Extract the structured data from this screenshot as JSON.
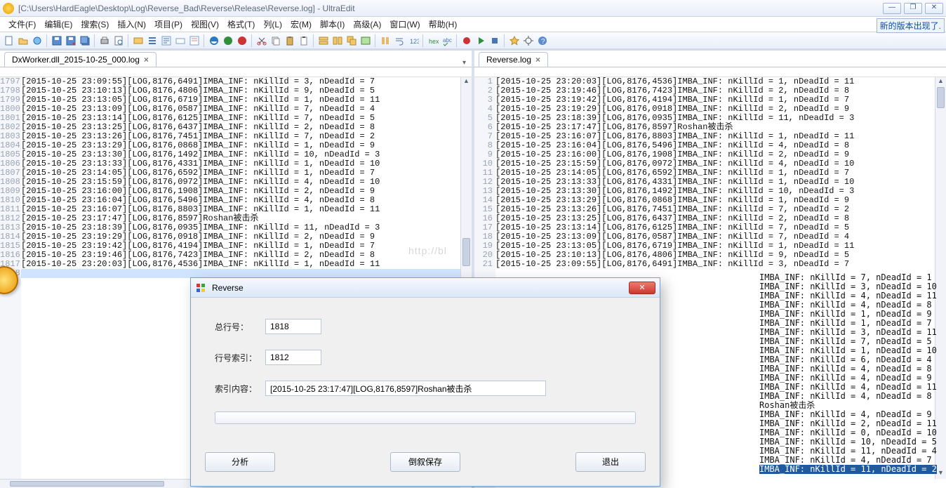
{
  "app": {
    "title": "[C:\\Users\\HardEagle\\Desktop\\Log\\Reverse_Bad\\Reverse\\Release\\Reverse.log] - UltraEdit",
    "new_version": "新的版本出现了."
  },
  "menu": [
    "文件(F)",
    "编辑(E)",
    "搜索(S)",
    "插入(N)",
    "项目(P)",
    "视图(V)",
    "格式(T)",
    "列(L)",
    "宏(M)",
    "脚本(I)",
    "高级(A)",
    "窗口(W)",
    "帮助(H)"
  ],
  "tabs": {
    "left": "DxWorker.dll_2015-10-25_000.log",
    "right": "Reverse.log"
  },
  "left_editor": {
    "first_lineno": 1797,
    "lines": [
      "[2015-10-25 23:09:55][LOG,8176,6491]IMBA_INF: nKillId = 3, nDeadId = 7",
      "[2015-10-25 23:10:13][LOG,8176,4806]IMBA_INF: nKillId = 9, nDeadId = 5",
      "[2015-10-25 23:13:05][LOG,8176,6719]IMBA_INF: nKillId = 1, nDeadId = 11",
      "[2015-10-25 23:13:09][LOG,8176,0587]IMBA_INF: nKillId = 7, nDeadId = 4",
      "[2015-10-25 23:13:14][LOG,8176,6125]IMBA_INF: nKillId = 7, nDeadId = 5",
      "[2015-10-25 23:13:25][LOG,8176,6437]IMBA_INF: nKillId = 2, nDeadId = 8",
      "[2015-10-25 23:13:26][LOG,8176,7451]IMBA_INF: nKillId = 7, nDeadId = 2",
      "[2015-10-25 23:13:29][LOG,8176,0868]IMBA_INF: nKillId = 1, nDeadId = 9",
      "[2015-10-25 23:13:30][LOG,8176,1492]IMBA_INF: nKillId = 10, nDeadId = 3",
      "[2015-10-25 23:13:33][LOG,8176,4331]IMBA_INF: nKillId = 1, nDeadId = 10",
      "[2015-10-25 23:14:05][LOG,8176,6592]IMBA_INF: nKillId = 1, nDeadId = 7",
      "[2015-10-25 23:15:59][LOG,8176,0972]IMBA_INF: nKillId = 4, nDeadId = 10",
      "[2015-10-25 23:16:00][LOG,8176,1908]IMBA_INF: nKillId = 2, nDeadId = 9",
      "[2015-10-25 23:16:04][LOG,8176,5496]IMBA_INF: nKillId = 4, nDeadId = 8",
      "[2015-10-25 23:16:07][LOG,8176,8803]IMBA_INF: nKillId = 1, nDeadId = 11",
      "[2015-10-25 23:17:47][LOG,8176,8597]Roshan被击杀",
      "[2015-10-25 23:18:39][LOG,8176,0935]IMBA_INF: nKillId = 11, nDeadId = 3",
      "[2015-10-25 23:19:29][LOG,8176,0918]IMBA_INF: nKillId = 2, nDeadId = 9",
      "[2015-10-25 23:19:42][LOG,8176,4194]IMBA_INF: nKillId = 1, nDeadId = 7",
      "[2015-10-25 23:19:46][LOG,8176,7423]IMBA_INF: nKillId = 2, nDeadId = 8",
      "[2015-10-25 23:20:03][LOG,8176,4536]IMBA_INF: nKillId = 1, nDeadId = 11"
    ],
    "selected_index_after_last": true
  },
  "right_editor": {
    "first_lineno": 1,
    "lines": [
      "[2015-10-25 23:20:03][LOG,8176,4536]IMBA_INF: nKillId = 1, nDeadId = 11",
      "[2015-10-25 23:19:46][LOG,8176,7423]IMBA_INF: nKillId = 2, nDeadId = 8",
      "[2015-10-25 23:19:42][LOG,8176,4194]IMBA_INF: nKillId = 1, nDeadId = 7",
      "[2015-10-25 23:19:29][LOG,8176,0918]IMBA_INF: nKillId = 2, nDeadId = 9",
      "[2015-10-25 23:18:39][LOG,8176,0935]IMBA_INF: nKillId = 11, nDeadId = 3",
      "[2015-10-25 23:17:47][LOG,8176,8597]Roshan被击杀",
      "[2015-10-25 23:16:07][LOG,8176,8803]IMBA_INF: nKillId = 1, nDeadId = 11",
      "[2015-10-25 23:16:04][LOG,8176,5496]IMBA_INF: nKillId = 4, nDeadId = 8",
      "[2015-10-25 23:16:00][LOG,8176,1908]IMBA_INF: nKillId = 2, nDeadId = 9",
      "[2015-10-25 23:15:59][LOG,8176,0972]IMBA_INF: nKillId = 4, nDeadId = 10",
      "[2015-10-25 23:14:05][LOG,8176,6592]IMBA_INF: nKillId = 1, nDeadId = 7",
      "[2015-10-25 23:13:33][LOG,8176,4331]IMBA_INF: nKillId = 1, nDeadId = 10",
      "[2015-10-25 23:13:30][LOG,8176,1492]IMBA_INF: nKillId = 10, nDeadId = 3",
      "[2015-10-25 23:13:29][LOG,8176,0868]IMBA_INF: nKillId = 1, nDeadId = 9",
      "[2015-10-25 23:13:26][LOG,8176,7451]IMBA_INF: nKillId = 7, nDeadId = 2",
      "[2015-10-25 23:13:25][LOG,8176,6437]IMBA_INF: nKillId = 2, nDeadId = 8",
      "[2015-10-25 23:13:14][LOG,8176,6125]IMBA_INF: nKillId = 7, nDeadId = 5",
      "[2015-10-25 23:13:09][LOG,8176,0587]IMBA_INF: nKillId = 7, nDeadId = 4",
      "[2015-10-25 23:13:05][LOG,8176,6719]IMBA_INF: nKillId = 1, nDeadId = 11",
      "[2015-10-25 23:10:13][LOG,8176,4806]IMBA_INF: nKillId = 9, nDeadId = 5",
      "[2015-10-25 23:09:55][LOG,8176,6491]IMBA_INF: nKillId = 3, nDeadId = 7"
    ]
  },
  "right_overflow_fragment": [
    "IMBA_INF: nKillId = 7, nDeadId = 1",
    "IMBA_INF: nKillId = 3, nDeadId = 10",
    "IMBA_INF: nKillId = 4, nDeadId = 11",
    "IMBA_INF: nKillId = 4, nDeadId = 8",
    "IMBA_INF: nKillId = 1, nDeadId = 9",
    "IMBA_INF: nKillId = 1, nDeadId = 7",
    "IMBA_INF: nKillId = 3, nDeadId = 11",
    "IMBA_INF: nKillId = 7, nDeadId = 5",
    "IMBA_INF: nKillId = 1, nDeadId = 10",
    "IMBA_INF: nKillId = 6, nDeadId = 4",
    "IMBA_INF: nKillId = 4, nDeadId = 8",
    "IMBA_INF: nKillId = 4, nDeadId = 9",
    "IMBA_INF: nKillId = 4, nDeadId = 11",
    "IMBA_INF: nKillId = 4, nDeadId = 8",
    "Roshan被击杀",
    "IMBA_INF: nKillId = 4, nDeadId = 9",
    "IMBA_INF: nKillId = 2, nDeadId = 11",
    "IMBA_INF: nKillId = 0, nDeadId = 10",
    "IMBA_INF: nKillId = 10, nDeadId = 5",
    "IMBA_INF: nKillId = 11, nDeadId = 4",
    "IMBA_INF: nKillId = 4, nDeadId = 7"
  ],
  "right_overflow_highlight": "IMBA_INF: nKillId = 11, nDeadId = 2",
  "dialog": {
    "title": "Reverse",
    "total_label": "总行号：",
    "total_value": "1818",
    "index_label": "行号索引：",
    "index_value": "1812",
    "content_label": "索引内容：",
    "content_value": "[2015-10-25 23:17:47][LOG,8176,8597]Roshan被击杀",
    "btn_analyze": "分析",
    "btn_reverse_save": "倒叙保存",
    "btn_exit": "退出"
  },
  "watermark": "http://bl"
}
